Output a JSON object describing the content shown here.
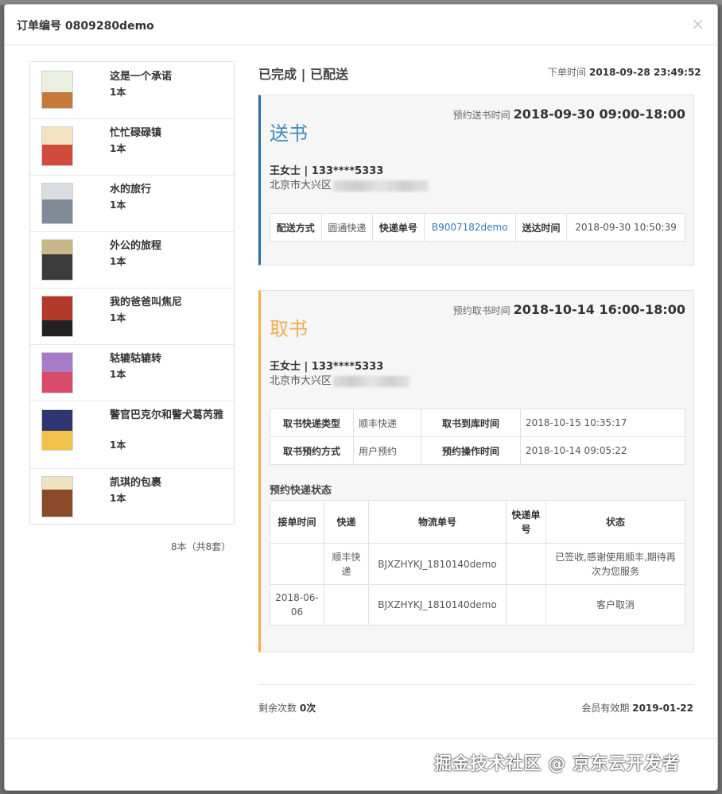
{
  "modal": {
    "title": "订单编号 0809280demo",
    "close_icon": "×"
  },
  "books": {
    "items": [
      {
        "name": "这是一个承诺",
        "qty": "1本",
        "cover_colors": [
          "#e9f0e0",
          "#c47a3a"
        ]
      },
      {
        "name": "忙忙碌碌镇",
        "qty": "1本",
        "cover_colors": [
          "#f3e2c2",
          "#d24a3a"
        ]
      },
      {
        "name": "水的旅行",
        "qty": "1本",
        "cover_colors": [
          "#d9dde2",
          "#7f8b98"
        ]
      },
      {
        "name": "外公的旅程",
        "qty": "1本",
        "cover_colors": [
          "#c9b78a",
          "#3b3b3b"
        ]
      },
      {
        "name": "我的爸爸叫焦尼",
        "qty": "1本",
        "cover_colors": [
          "#b33a2a",
          "#222222"
        ]
      },
      {
        "name": "轱辘轱辘转",
        "qty": "1本",
        "cover_colors": [
          "#a77bc9",
          "#d84b6a"
        ]
      },
      {
        "name": "警官巴克尔和警犬葛芮雅",
        "qty": "1本",
        "cover_colors": [
          "#2f3570",
          "#f0c24a"
        ]
      },
      {
        "name": "凯琪的包裹",
        "qty": "1本",
        "cover_colors": [
          "#efe2c2",
          "#8a4a2a"
        ]
      }
    ],
    "total": "8本（共8套）"
  },
  "order": {
    "status": "已完成 | 已配送",
    "order_time_label": "下单时间",
    "order_time": "2018-09-28 23:49:52"
  },
  "deliver": {
    "title": "送书",
    "accent": "#2d6fa3",
    "sched_label": "预约送书时间",
    "sched_value": "2018-09-30 09:00-18:00",
    "recipient": "王女士 | 133****5333",
    "address": "北京市大兴区",
    "table": {
      "method_label": "配送方式",
      "method_value": "圆通快递",
      "tracking_label": "快递单号",
      "tracking_value": "B9007182demo",
      "arrive_label": "送达时间",
      "arrive_value": "2018-09-30 10:50:39"
    }
  },
  "pickup": {
    "title": "取书",
    "accent": "#f0ad4e",
    "sched_label": "预约取书时间",
    "sched_value": "2018-10-14 16:00-18:00",
    "recipient": "王女士 | 133****5333",
    "address": "北京市大兴区",
    "table": {
      "type_label": "取书快递类型",
      "type_value": "顺丰快递",
      "arrive_label": "取书到库时间",
      "arrive_value": "2018-10-15 10:35:17",
      "way_label": "取书预约方式",
      "way_value": "用户预约",
      "op_label": "预约操作时间",
      "op_value": "2018-10-14 09:05:22"
    },
    "status_section": "预约快递状态",
    "status_headers": [
      "接单时间",
      "快递",
      "物流单号",
      "快递单号",
      "状态"
    ],
    "status_rows": [
      {
        "time": "",
        "courier": "顺丰快递",
        "logistics_no": "BJXZHYKJ_1810140demo",
        "courier_no": "",
        "status": "已签收,感谢使用顺丰,期待再次为您服务"
      },
      {
        "time": "2018-06-06",
        "courier": "",
        "logistics_no": "BJXZHYKJ_1810140demo",
        "courier_no": "",
        "status": "客户取消"
      }
    ]
  },
  "footer": {
    "remain_label": "剩余次数",
    "remain_value": "0次",
    "expire_label": "会员有效期",
    "expire_value": "2019-01-22"
  },
  "watermark": "掘金技术社区 @ 京东云开发者"
}
